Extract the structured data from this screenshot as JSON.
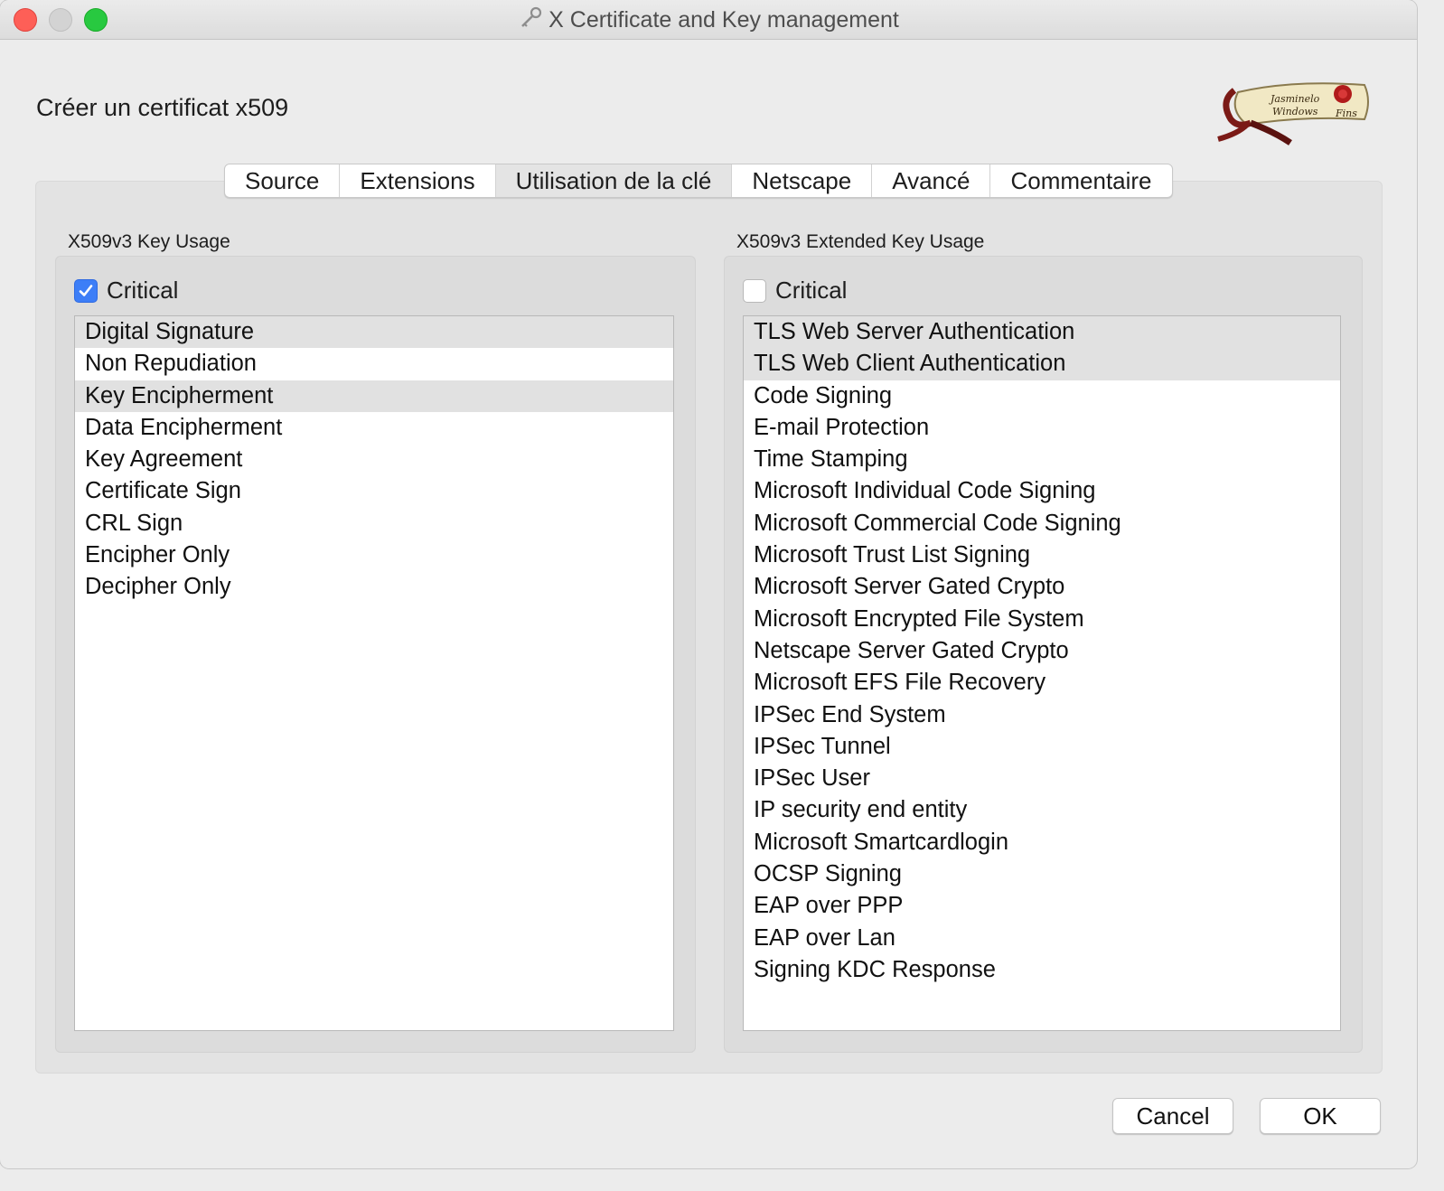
{
  "window": {
    "title": "X Certificate and Key management"
  },
  "heading": "Créer un certificat x509",
  "tabs": [
    {
      "label": "Source",
      "active": false
    },
    {
      "label": "Extensions",
      "active": false
    },
    {
      "label": "Utilisation de la clé",
      "active": true
    },
    {
      "label": "Netscape",
      "active": false
    },
    {
      "label": "Avancé",
      "active": false
    },
    {
      "label": "Commentaire",
      "active": false
    }
  ],
  "key_usage": {
    "label": "X509v3 Key Usage",
    "critical_label": "Critical",
    "critical_checked": true,
    "items": [
      {
        "label": "Digital Signature",
        "selected": true
      },
      {
        "label": "Non Repudiation",
        "selected": false
      },
      {
        "label": "Key Encipherment",
        "selected": true
      },
      {
        "label": "Data Encipherment",
        "selected": false
      },
      {
        "label": "Key Agreement",
        "selected": false
      },
      {
        "label": "Certificate Sign",
        "selected": false
      },
      {
        "label": "CRL Sign",
        "selected": false
      },
      {
        "label": "Encipher Only",
        "selected": false
      },
      {
        "label": "Decipher Only",
        "selected": false
      }
    ]
  },
  "extended_key_usage": {
    "label": "X509v3 Extended Key Usage",
    "critical_label": "Critical",
    "critical_checked": false,
    "items": [
      {
        "label": "TLS Web Server Authentication",
        "selected": true
      },
      {
        "label": "TLS Web Client Authentication",
        "selected": true
      },
      {
        "label": "Code Signing",
        "selected": false
      },
      {
        "label": "E-mail Protection",
        "selected": false
      },
      {
        "label": "Time Stamping",
        "selected": false
      },
      {
        "label": "Microsoft Individual Code Signing",
        "selected": false
      },
      {
        "label": "Microsoft Commercial Code Signing",
        "selected": false
      },
      {
        "label": "Microsoft Trust List Signing",
        "selected": false
      },
      {
        "label": "Microsoft Server Gated Crypto",
        "selected": false
      },
      {
        "label": "Microsoft Encrypted File System",
        "selected": false
      },
      {
        "label": "Netscape Server Gated Crypto",
        "selected": false
      },
      {
        "label": "Microsoft EFS File Recovery",
        "selected": false
      },
      {
        "label": "IPSec End System",
        "selected": false
      },
      {
        "label": "IPSec Tunnel",
        "selected": false
      },
      {
        "label": "IPSec User",
        "selected": false
      },
      {
        "label": "IP security end entity",
        "selected": false
      },
      {
        "label": "Microsoft Smartcardlogin",
        "selected": false
      },
      {
        "label": "OCSP Signing",
        "selected": false
      },
      {
        "label": "EAP over PPP",
        "selected": false
      },
      {
        "label": "EAP over Lan",
        "selected": false
      },
      {
        "label": "Signing KDC Response",
        "selected": false
      }
    ]
  },
  "buttons": {
    "cancel": "Cancel",
    "ok": "OK"
  },
  "logo": {
    "text_line1": "Jasminelo",
    "text_line2": "Windows",
    "text_line3": "Fins"
  },
  "colors": {
    "accent": "#3d7ef7",
    "selection": "#e1e1e1",
    "close": "#fe5f57",
    "maximize": "#28c940"
  }
}
